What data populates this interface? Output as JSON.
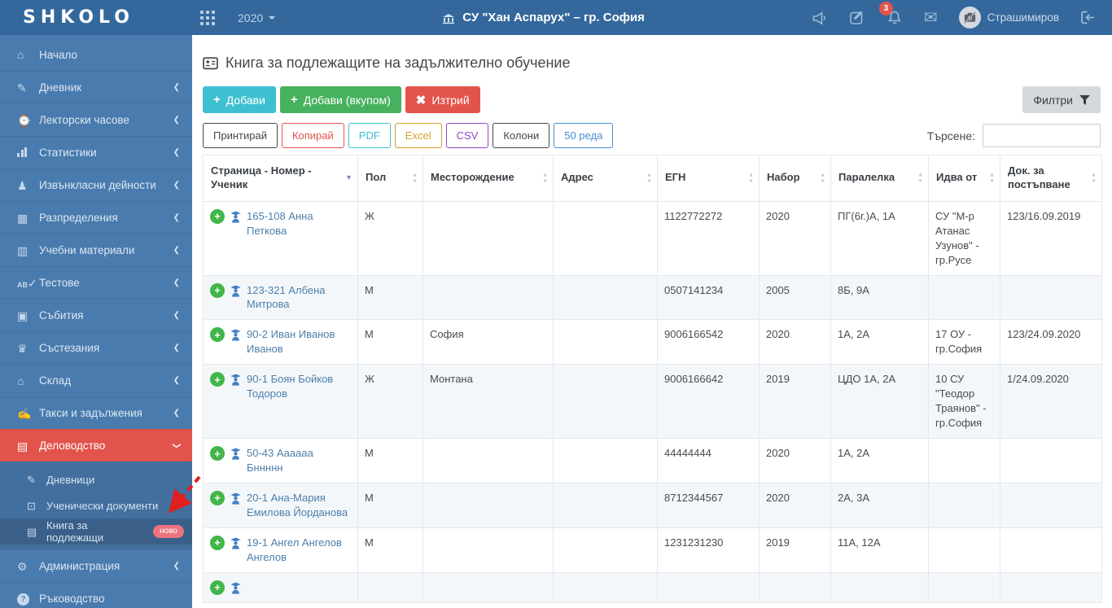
{
  "topbar": {
    "brand": "SHKOLO",
    "year": "2020",
    "school_name": "СУ \"Хан Аспарух\" – гр. София",
    "notification_count": "3",
    "user_name": "Страшимиров"
  },
  "sidebar": {
    "items": [
      {
        "label": "Начало",
        "icon": "home-icon"
      },
      {
        "label": "Дневник",
        "icon": "edit-icon",
        "expandable": true
      },
      {
        "label": "Лекторски часове",
        "icon": "briefcase-clock-icon",
        "expandable": true
      },
      {
        "label": "Статистики",
        "icon": "chart-icon",
        "expandable": true
      },
      {
        "label": "Извънкласни дейности",
        "icon": "runner-icon",
        "expandable": true
      },
      {
        "label": "Разпределения",
        "icon": "grid-table-icon",
        "expandable": true
      },
      {
        "label": "Учебни материали",
        "icon": "books-icon",
        "expandable": true
      },
      {
        "label": "Тестове",
        "icon": "ab-test-icon",
        "expandable": true
      },
      {
        "label": "Събития",
        "icon": "calendar-icon",
        "expandable": true
      },
      {
        "label": "Състезания",
        "icon": "trophy-icon",
        "expandable": true
      },
      {
        "label": "Склад",
        "icon": "warehouse-icon",
        "expandable": true
      },
      {
        "label": "Такси и задължения",
        "icon": "fees-icon",
        "expandable": true
      },
      {
        "label": "Деловодство",
        "icon": "document-icon",
        "expanded": true,
        "active": true
      }
    ],
    "submenu": [
      {
        "label": "Дневници",
        "icon": "edit-icon"
      },
      {
        "label": "Ученически документи",
        "icon": "id-card-icon"
      },
      {
        "label": "Книга за подлежащи",
        "icon": "contact-book-icon",
        "badge": "ново",
        "active": true
      }
    ],
    "bottom": [
      {
        "label": "Администрация",
        "icon": "gears-icon",
        "expandable": true
      },
      {
        "label": "Ръководство",
        "icon": "question-icon"
      }
    ]
  },
  "main": {
    "page_title": "Книга за подлежащите на задължително обучение",
    "actions": {
      "add": "Добави",
      "add_bulk": "Добави (вкупом)",
      "delete": "Изтрий",
      "filters": "Филтри"
    },
    "toolbar": {
      "print": "Принтирай",
      "copy": "Копирай",
      "pdf": "PDF",
      "excel": "Excel",
      "csv": "CSV",
      "columns": "Колони",
      "rows": "50 реда"
    },
    "search_label": "Търсене:",
    "search_value": ""
  },
  "table": {
    "headers": [
      "Страница - Номер - Ученик",
      "Пол",
      "Месторождение",
      "Адрес",
      "ЕГН",
      "Набор",
      "Паралелка",
      "Идва от",
      "Док. за постъпване"
    ],
    "sorted_column": "Страница - Номер - Ученик",
    "sort_direction": "desc",
    "rows": [
      {
        "student": "165-108 Анна Петкова",
        "gender": "Ж",
        "birthplace": "",
        "address": "",
        "egn": "1122772272",
        "year": "2020",
        "class": "ПГ(6г.)А, 1А",
        "comes_from": "СУ \"М-р Атанас Узунов\" - гр.Русе",
        "entry_doc": "123/16.09.2019"
      },
      {
        "student": "123-321 Албена Митрова",
        "gender": "М",
        "birthplace": "",
        "address": "",
        "egn": "0507141234",
        "year": "2005",
        "class": "8Б, 9А",
        "comes_from": "",
        "entry_doc": ""
      },
      {
        "student": "90-2 Иван Иванов Иванов",
        "gender": "М",
        "birthplace": "София",
        "address": "",
        "egn": "9006166542",
        "year": "2020",
        "class": "1А, 2А",
        "comes_from": "17 ОУ - гр.София",
        "entry_doc": "123/24.09.2020"
      },
      {
        "student": "90-1 Боян Бойков Тодоров",
        "gender": "Ж",
        "birthplace": "Монтана",
        "address": "",
        "egn": "9006166642",
        "year": "2019",
        "class": "ЦДО 1А, 2А",
        "comes_from": "10 СУ \"Теодор Траянов\" - гр.София",
        "entry_doc": "1/24.09.2020"
      },
      {
        "student": "50-43 Аааааа Бннннн",
        "gender": "М",
        "birthplace": "",
        "address": "",
        "egn": "44444444",
        "year": "2020",
        "class": "1А, 2А",
        "comes_from": "",
        "entry_doc": ""
      },
      {
        "student": "20-1 Ана-Мария Емилова Йорданова",
        "gender": "М",
        "birthplace": "",
        "address": "",
        "egn": "8712344567",
        "year": "2020",
        "class": "2А, 3А",
        "comes_from": "",
        "entry_doc": ""
      },
      {
        "student": "19-1 Ангел Ангелов Ангелов",
        "gender": "М",
        "birthplace": "",
        "address": "",
        "egn": "1231231230",
        "year": "2019",
        "class": "11А, 12А",
        "comes_from": "",
        "entry_doc": ""
      },
      {
        "student": "",
        "gender": "",
        "birthplace": "",
        "address": "",
        "egn": "",
        "year": "",
        "class": "",
        "comes_from": "",
        "entry_doc": ""
      }
    ]
  },
  "annotation": {
    "type": "red-dashed-arrow",
    "points_to": "Книга за подлежащи"
  },
  "colors": {
    "topbar_blue": "#34689c",
    "sidebar_blue": "#4a7bae",
    "active_red": "#e2544b",
    "new_badge_pink": "#ec7480",
    "btn_add_cyan": "#3fc0d1",
    "btn_bulk_green": "#46b15e",
    "btn_delete_red": "#e2544b",
    "filters_gray": "#d5d9dd",
    "link_blue": "#4d7fab",
    "plus_green": "#42b649",
    "pdf_cyan": "#3fc0d1",
    "excel_gold": "#d4a12d",
    "csv_purple": "#9146c8",
    "rows_blue": "#4a8cd3",
    "sort_active_indigo": "#7b86d8",
    "annotation_red": "#e01f1f"
  }
}
